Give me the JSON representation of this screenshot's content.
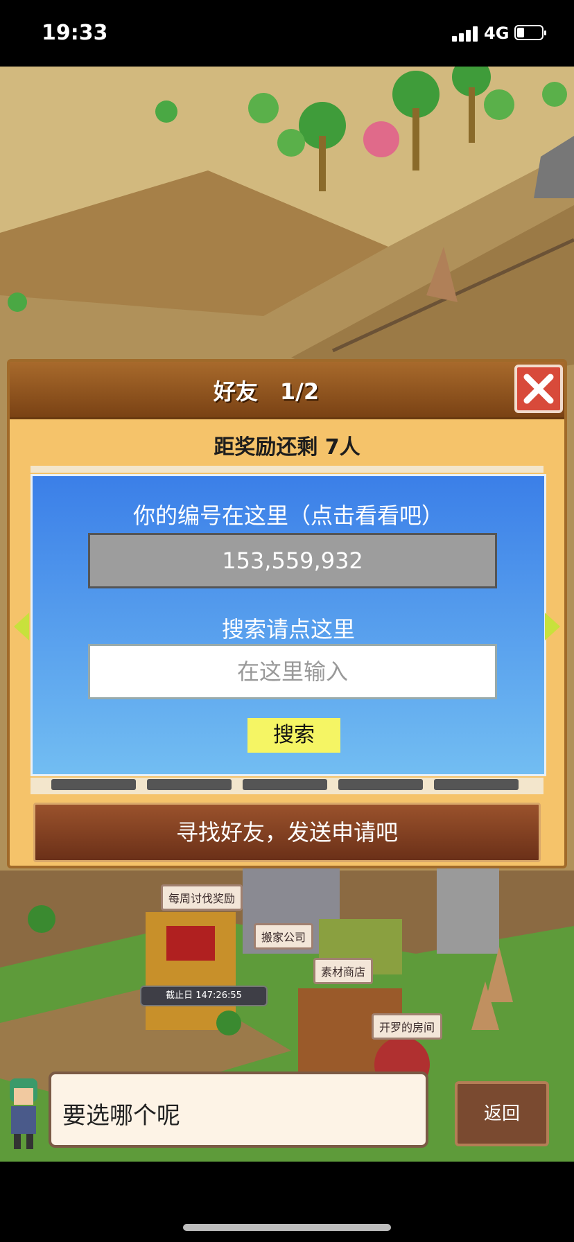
{
  "status_bar": {
    "time": "19:33",
    "network": "4G"
  },
  "dialog": {
    "title": "好友　1/2",
    "reward_text": "距奖励还剩 7人",
    "id_caption": "你的编号在这里（点击看看吧）",
    "player_id": "153,559,932",
    "search_caption": "搜索请点这里",
    "search_placeholder": "在这里输入",
    "search_button": "搜索",
    "find_friends_button": "寻找好友，发送申请吧"
  },
  "map_labels": {
    "weekly_reward": "每周讨伐奖励",
    "moving_company": "搬家公司",
    "material_shop": "素材商店",
    "cairo_room": "开罗的房间",
    "deadline": "截止日 147:26:55"
  },
  "bottom": {
    "speech": "要选哪个呢",
    "back_button": "返回"
  },
  "colors": {
    "dialog_frame": "#f5c36a",
    "panel_blue": "#3b7fe8",
    "close_red": "#d84a3a",
    "search_yellow": "#f5f564"
  }
}
